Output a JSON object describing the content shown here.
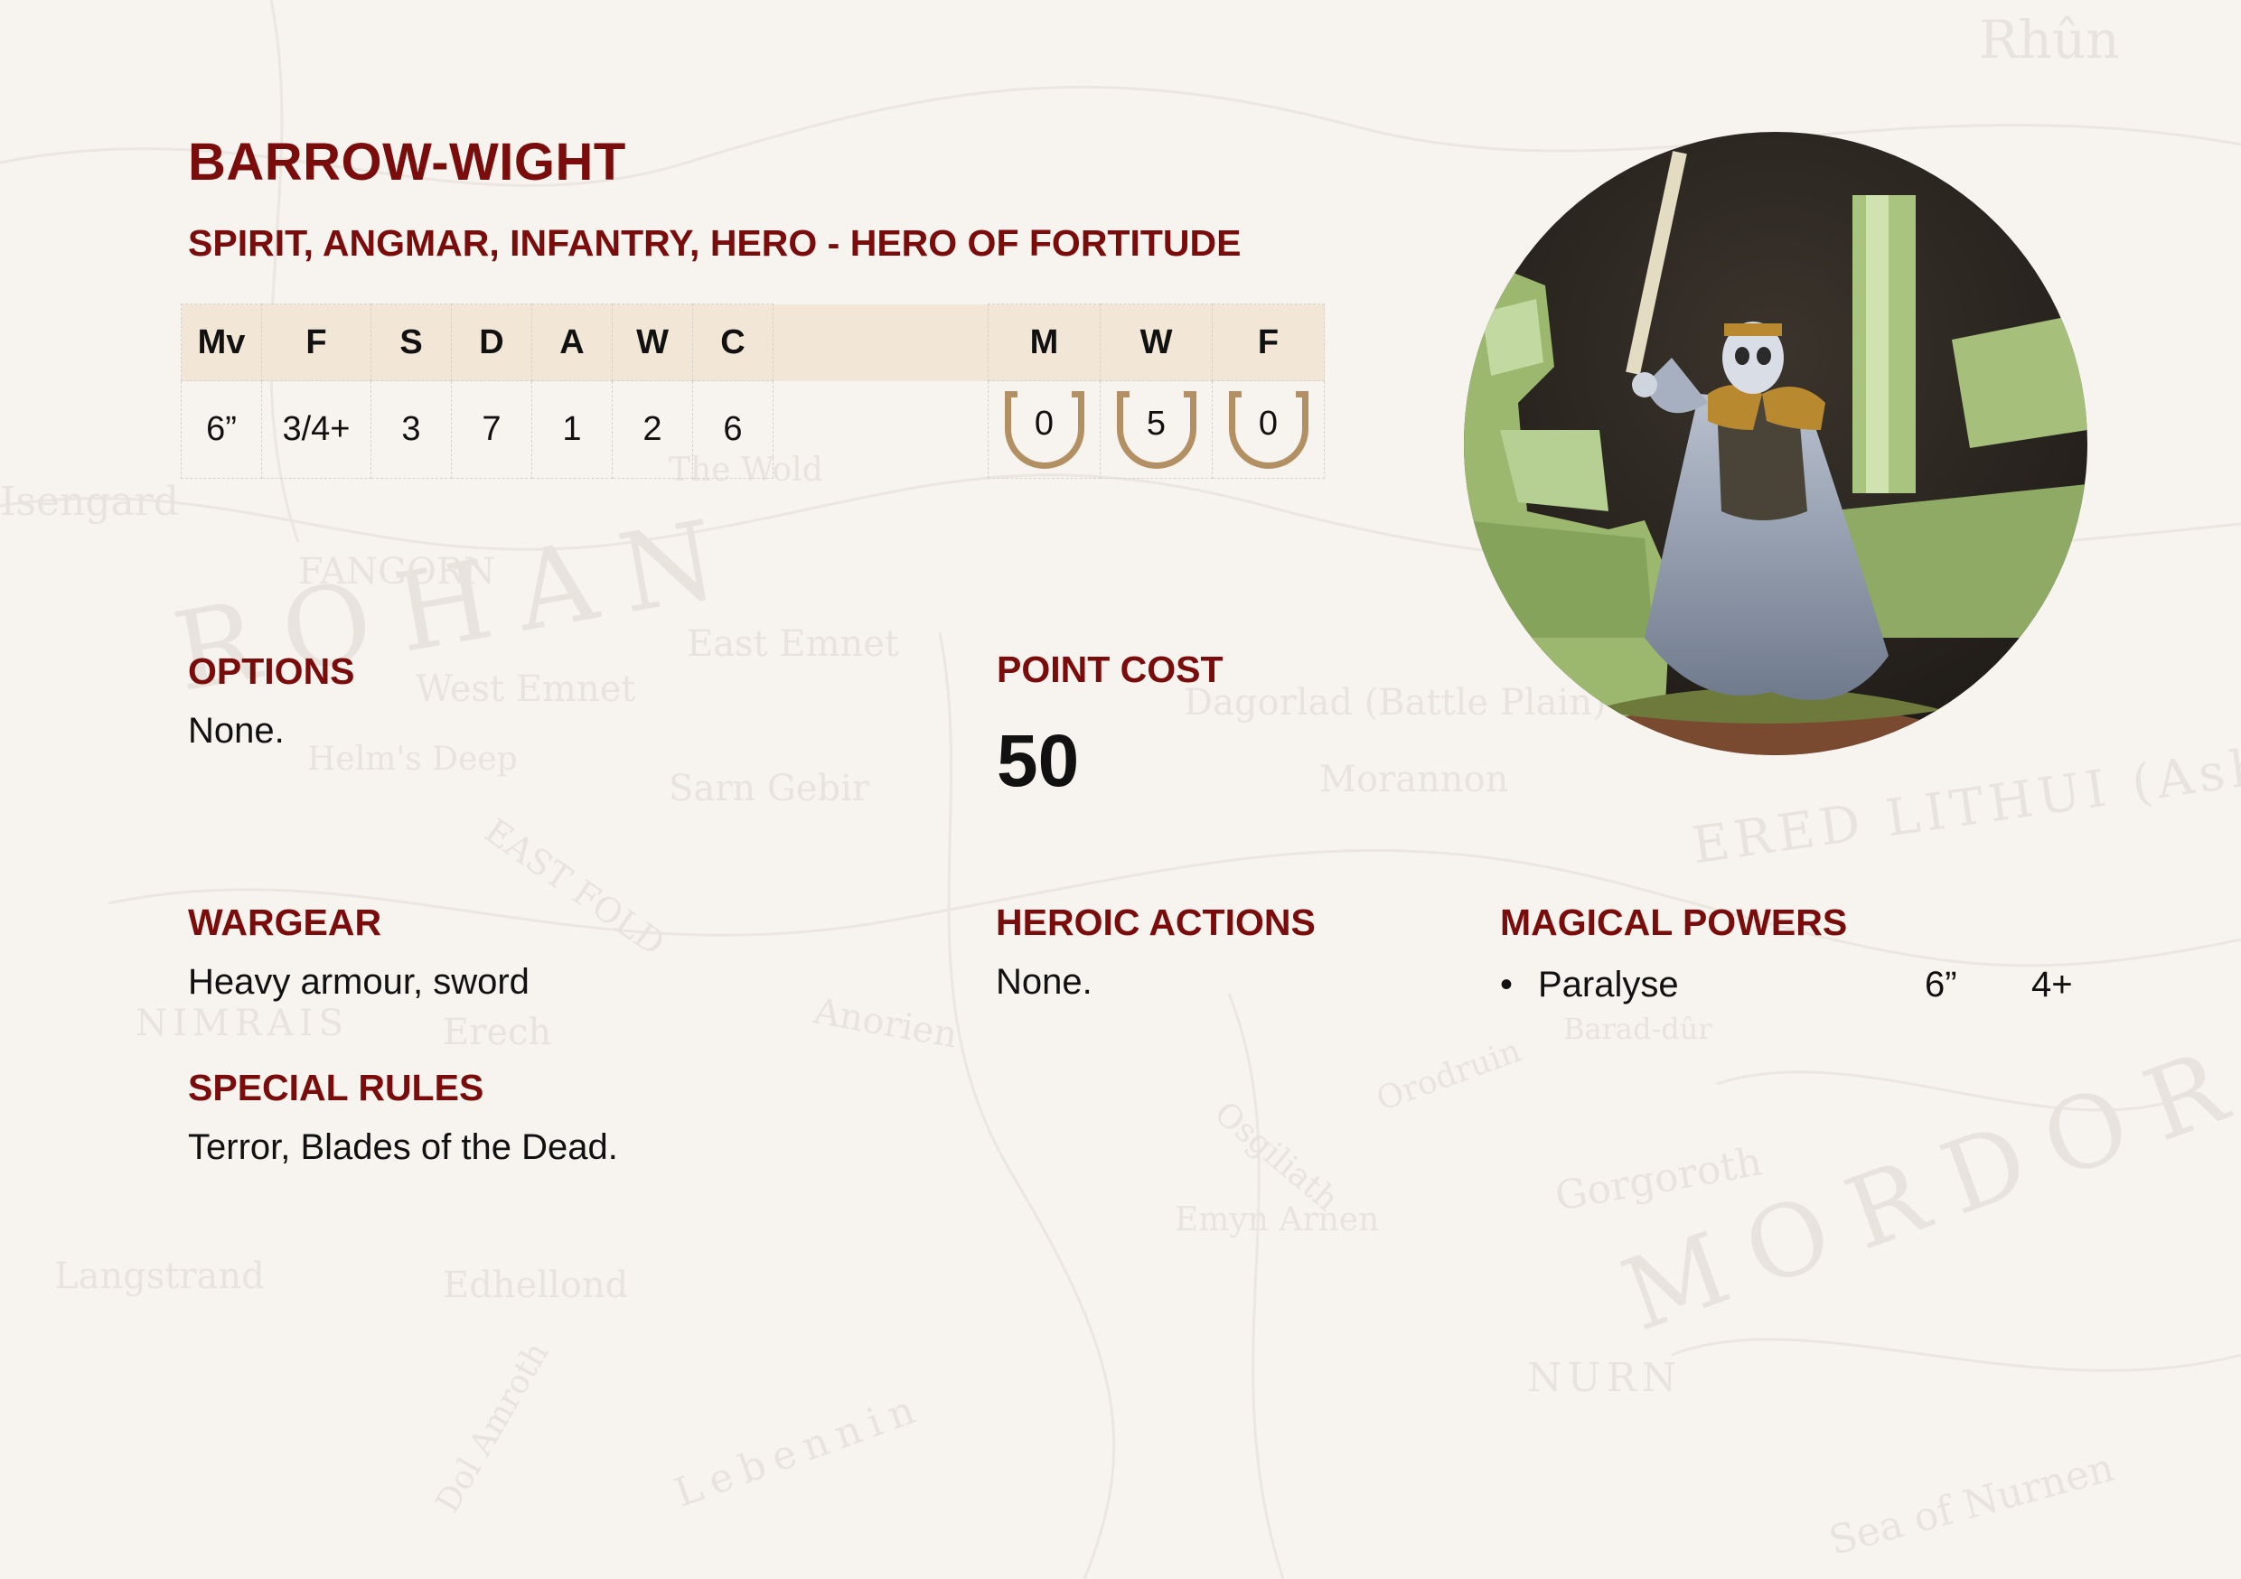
{
  "unit": {
    "name": "BARROW-WIGHT",
    "keywords": "SPIRIT, ANGMAR, INFANTRY, HERO - HERO OF FORTITUDE"
  },
  "stats": {
    "headers": [
      "Mv",
      "F",
      "S",
      "D",
      "A",
      "W",
      "C"
    ],
    "values": [
      "6”",
      "3/4+",
      "3",
      "7",
      "1",
      "2",
      "6"
    ]
  },
  "hero_stats": {
    "headers": [
      "M",
      "W",
      "F"
    ],
    "values": [
      "0",
      "5",
      "0"
    ]
  },
  "options": {
    "heading": "OPTIONS",
    "text": "None."
  },
  "point_cost": {
    "heading": "POINT COST",
    "value": "50"
  },
  "wargear": {
    "heading": "WARGEAR",
    "text": "Heavy armour, sword"
  },
  "heroic_actions": {
    "heading": "HEROIC ACTIONS",
    "text": "None."
  },
  "magical_powers": {
    "heading": "MAGICAL POWERS",
    "items": [
      {
        "name": "Paralyse",
        "range": "6”",
        "casting": "4+"
      }
    ]
  },
  "special_rules": {
    "heading": "SPECIAL RULES",
    "text": "Terror, Blades of the Dead."
  },
  "background_map_labels": [
    "Rhûn",
    "ROHAN",
    "MORDOR",
    "Dagorlad (Battle Plain)",
    "ERED LITHUI (Ash",
    "Isengard",
    "FANGORN",
    "East Emnet",
    "West Emnet",
    "Sarn Gebir",
    "NIMRAIS",
    "Erech",
    "Edhellond",
    "NURN",
    "Gorgoroth",
    "Langstrand",
    "Emyn Arnen",
    "Helm's Deep",
    "EAST FOLD",
    "Anorien",
    "Morannon",
    "Sea of Nurnen",
    "Lebennin",
    "Dol Amroth",
    "Osgiliath",
    "Barad-dûr",
    "Orodruin",
    "The Wold"
  ],
  "colors": {
    "accent": "#7a0c0c",
    "header_fill": "#f2e7d7",
    "shield": "#b39064",
    "background": "#f7f4ef"
  },
  "image": {
    "subject": "painted miniature of the Barrow-wight with raised sword"
  }
}
